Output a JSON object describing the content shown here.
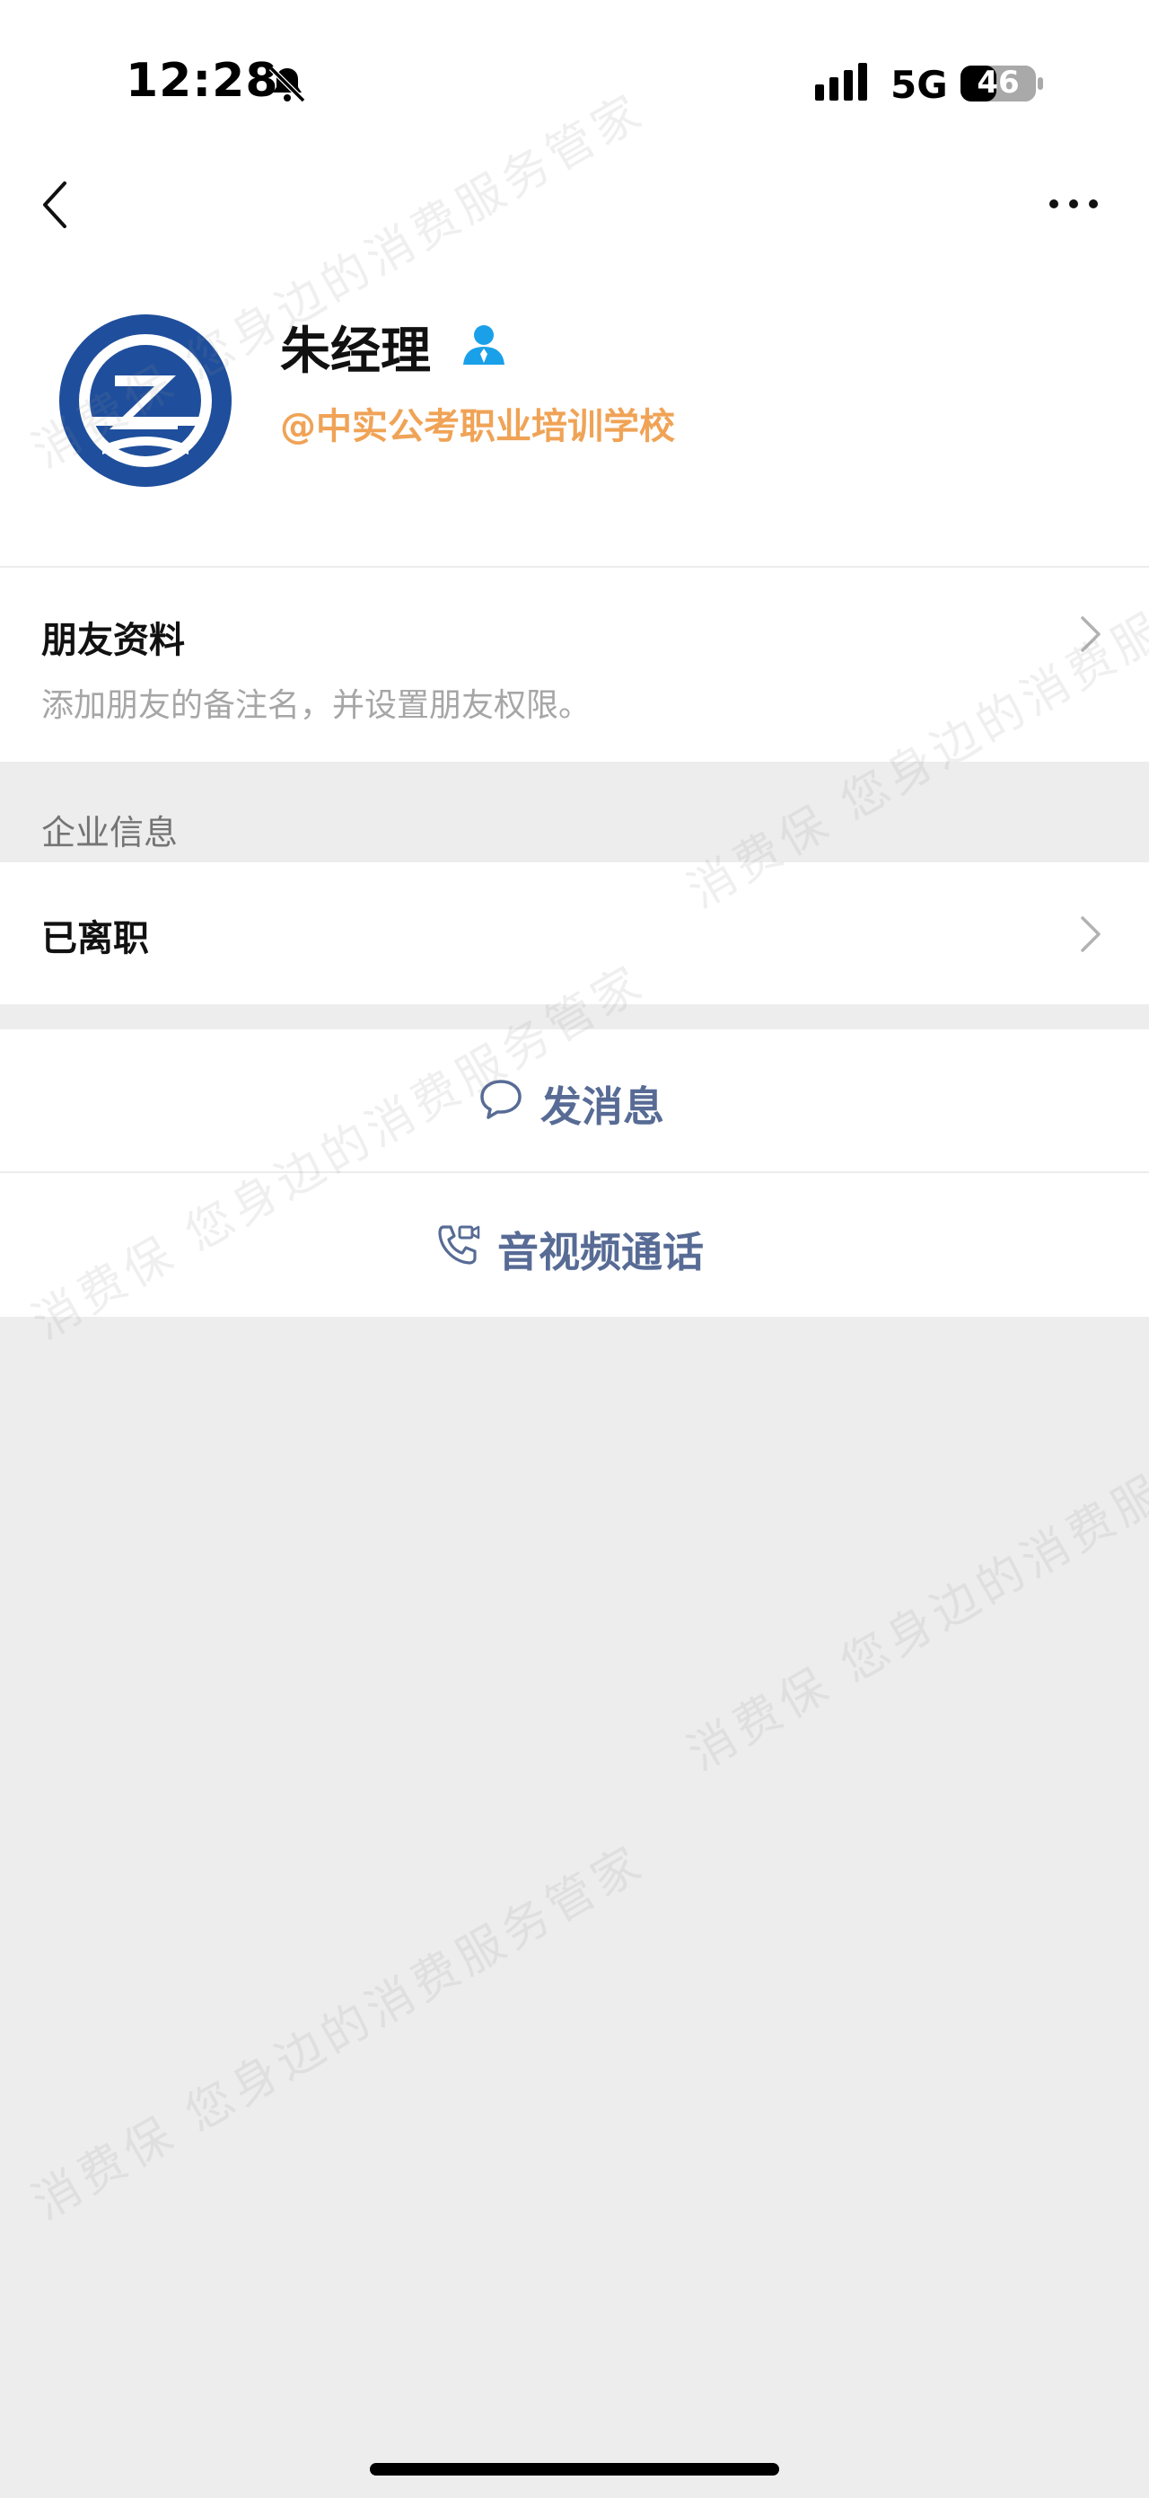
{
  "status_bar": {
    "time": "12:28",
    "network": "5G",
    "battery": "46"
  },
  "profile": {
    "name": "朱经理",
    "company": "@中实公考职业培训学校"
  },
  "friend_info": {
    "title": "朋友资料",
    "description": "添加朋友的备注名，并设置朋友权限。"
  },
  "enterprise": {
    "section_label": "企业信息",
    "status": "已离职"
  },
  "actions": {
    "message_label": "发消息",
    "call_label": "音视频通话"
  },
  "watermark": {
    "text": "消费保 您身边的消费服务管家"
  },
  "colors": {
    "accent_blue": "#576b95",
    "company_orange": "#f0a356",
    "badge_blue": "#1aa0e8",
    "background": "#ededed"
  }
}
